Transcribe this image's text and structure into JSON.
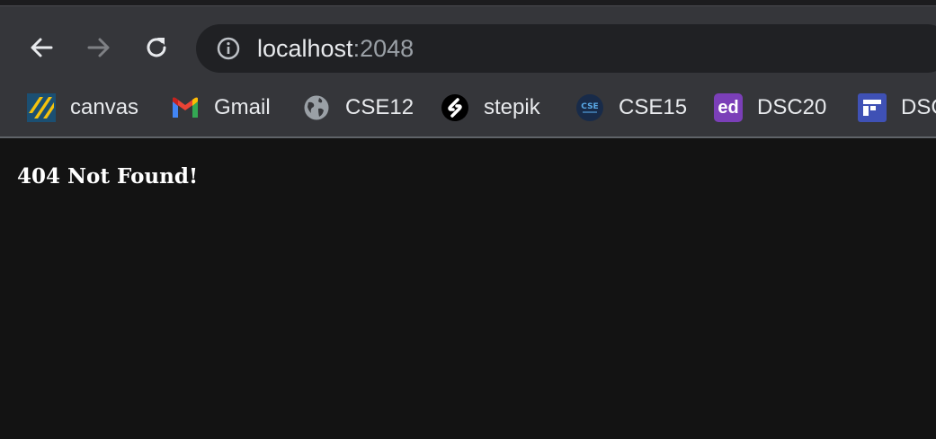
{
  "browser": {
    "address_bar": {
      "host": "localhost",
      "port": ":2048"
    },
    "bookmarks": [
      {
        "label": "canvas",
        "icon": "canvas-icon"
      },
      {
        "label": "Gmail",
        "icon": "gmail-icon"
      },
      {
        "label": "CSE12",
        "icon": "globe-icon"
      },
      {
        "label": "stepik",
        "icon": "stepik-icon"
      },
      {
        "label": "CSE15",
        "icon": "cse-icon",
        "icon_text": "CSE"
      },
      {
        "label": "DSC20",
        "icon": "ed-icon",
        "icon_text": "ed"
      },
      {
        "label": "DSC",
        "icon": "dsc-icon"
      }
    ],
    "colors": {
      "toolbar": "#35363a",
      "omnibox": "#202124",
      "page_background": "#131313",
      "ed_purple": "#7b3fb8",
      "dsc_blue": "#3f51b5"
    }
  },
  "page": {
    "message": "404 Not Found!"
  }
}
